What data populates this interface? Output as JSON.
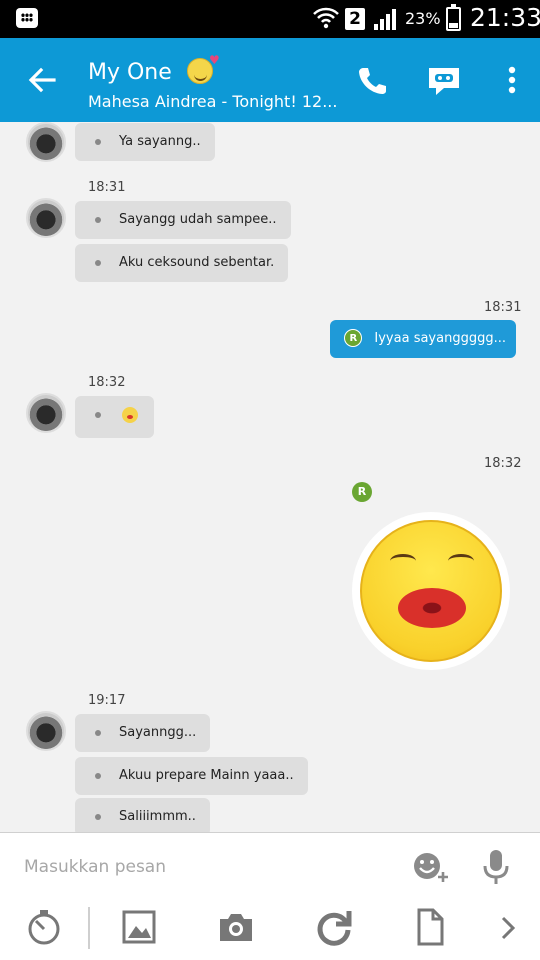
{
  "status_bar": {
    "sim_label": "2",
    "battery_percent": "23%",
    "time": "21:33",
    "battery_level": 0.23
  },
  "header": {
    "title": "My One",
    "subtitle": "Mahesa Aindrea - Tonight! 12..."
  },
  "messages": {
    "m1": {
      "text": "Ya sayanng.."
    },
    "group1": {
      "time": "18:31",
      "m1": "Sayangg udah sampee..",
      "m2": "Aku ceksound sebentar."
    },
    "out1": {
      "time": "18:31",
      "badge": "R",
      "text": "Iyyaa sayanggggg..."
    },
    "group2": {
      "time": "18:32"
    },
    "out2": {
      "time": "18:32",
      "badge": "R"
    },
    "group3": {
      "time": "19:17",
      "m1": "Sayanngg...",
      "m2": "Akuu prepare Mainn yaaa..",
      "m3": "Saliiimmm.."
    }
  },
  "composer": {
    "placeholder": "Masukkan pesan"
  },
  "colors": {
    "app_bar": "#0d99d6",
    "outgoing_bubble": "#1f9ad8",
    "incoming_bubble": "#dedede",
    "read_badge": "#6aa632"
  },
  "icons": {
    "status": [
      "bbm-icon",
      "wifi-icon",
      "signal-icon",
      "battery-icon"
    ],
    "app_bar": [
      "back-arrow-icon",
      "phone-icon",
      "video-chat-icon",
      "more-vert-icon"
    ],
    "composer": [
      "emoji-add-icon",
      "microphone-icon",
      "timer-icon",
      "image-icon",
      "camera-icon",
      "refresh-icon",
      "file-icon",
      "chevron-right-icon"
    ]
  }
}
